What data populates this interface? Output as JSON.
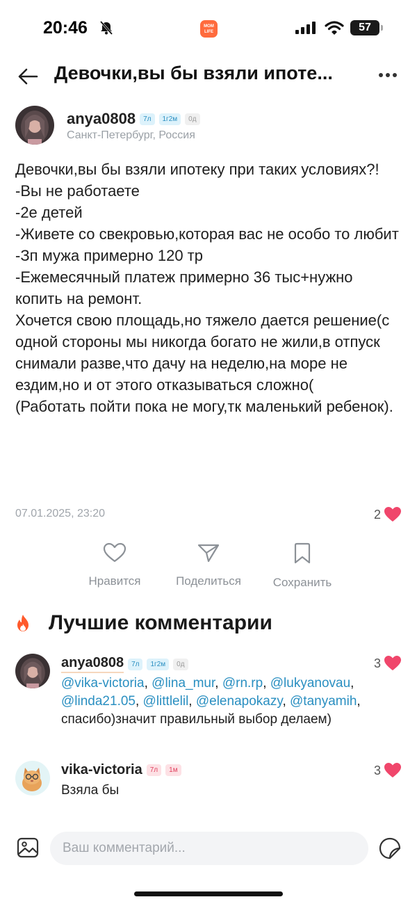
{
  "status_bar": {
    "time": "20:46",
    "app_badge": "MOM LIFE",
    "battery": "57"
  },
  "header": {
    "title": "Девочки,вы бы взяли ипоте..."
  },
  "post": {
    "author": {
      "name": "anya0808",
      "tags": [
        "7л",
        "1г2м",
        "0д"
      ],
      "location": "Санкт-Петербург, Россия"
    },
    "paragraphs": [
      "Девочки,вы бы взяли ипотеку при таких условиях?!",
      "-Вы не работаете",
      "-2е детей",
      "-Живете со свекровью,которая вас не особо то любит",
      "-Зп мужа примерно 120 тр",
      "-Ежемесячный платеж примерно 36 тыс+нужно копить на ремонт.",
      "Хочется свою площадь,но тяжело дается решение(с одной стороны мы никогда богато не жили,в отпуск снимали разве,что дачу на неделю,на море не ездим,но и от этого отказываться сложно(",
      "(Работать пойти пока не могу,тк маленький ребенок)."
    ],
    "date": "07.01.2025, 23:20",
    "likes": "2"
  },
  "actions": {
    "like_label": "Нравится",
    "share_label": "Поделиться",
    "save_label": "Сохранить"
  },
  "best_comments": {
    "title": "Лучшие комментарии",
    "items": [
      {
        "author": "anya0808",
        "tags": [
          "7л",
          "1г2м",
          "0д"
        ],
        "likes": "3",
        "mentions": [
          "@vika-victoria",
          "@lina_mur",
          "@rn.rp",
          "@lukyanovau",
          "@linda21.05",
          "@littlelil",
          "@elenapokazy",
          "@tanyamih"
        ],
        "text": "спасибо)значит правильный выбор делаем)"
      },
      {
        "author": "vika-victoria",
        "tags": [
          "7л",
          "1м"
        ],
        "likes": "3",
        "text": "Взяла бы"
      }
    ]
  },
  "comment_input": {
    "placeholder": "Ваш комментарий..."
  },
  "colors": {
    "accent_blue": "#2a8fc1",
    "heart": "#f0466b",
    "fire": "#ff5a2c"
  }
}
